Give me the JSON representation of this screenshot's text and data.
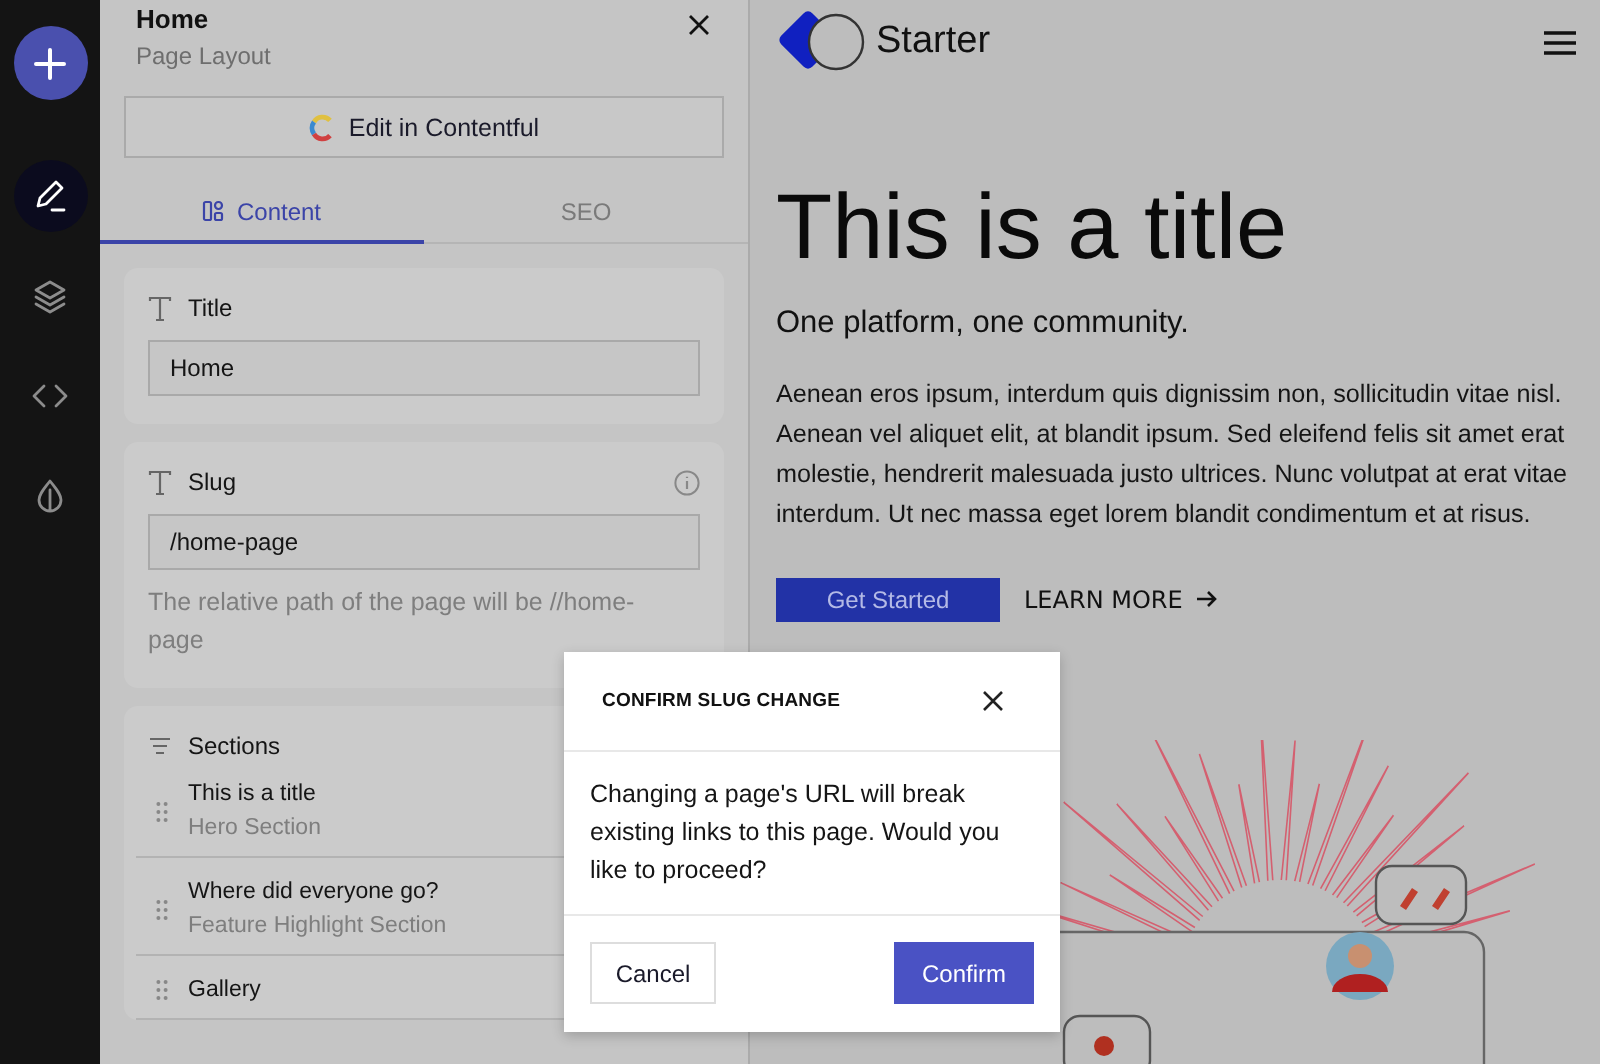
{
  "rail": {
    "items": [
      {
        "kind": "edit",
        "selected": true
      },
      {
        "kind": "layers",
        "selected": false
      },
      {
        "kind": "code",
        "selected": false
      },
      {
        "kind": "theme",
        "selected": false
      }
    ]
  },
  "panel": {
    "title": "Home",
    "subtitle": "Page Layout",
    "edit_button": "Edit in Contentful",
    "tabs": [
      {
        "label": "Content",
        "selected": true
      },
      {
        "label": "SEO",
        "selected": false
      }
    ],
    "fields": [
      {
        "label": "Title",
        "value": "Home"
      },
      {
        "label": "Slug",
        "value": "/home-page",
        "info": true,
        "help": "The relative path of the page will be //home-page"
      }
    ],
    "sections": {
      "label": "Sections",
      "items": [
        {
          "title": "This is a title",
          "type": "Hero Section"
        },
        {
          "title": "Where did everyone go?",
          "type": "Feature Highlight Section"
        },
        {
          "title": "Gallery"
        }
      ]
    }
  },
  "preview": {
    "brand": "Starter",
    "heading": "This is a title",
    "subheading": "One platform, one community.",
    "body": "Aenean eros ipsum, interdum quis dignissim non, sollicitudin vitae nisl. Aenean vel aliquet elit, at blandit ipsum. Sed eleifend felis sit amet erat molestie, hendrerit malesuada justo ultrices. Nunc volutpat at erat vitae interdum. Ut nec massa eget lorem blandit condimentum et at risus.",
    "primary_button": "Get Started",
    "link": "LEARN MORE"
  },
  "dialog": {
    "title": "CONFIRM SLUG CHANGE",
    "message": "Changing a page's URL will break existing links to this page. Would you like to proceed?",
    "buttons": [
      {
        "label": "Cancel",
        "kind": "secondary"
      },
      {
        "label": "Confirm",
        "kind": "primary"
      }
    ]
  }
}
